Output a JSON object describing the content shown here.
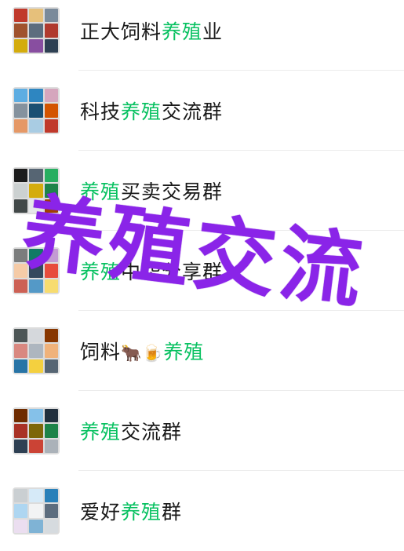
{
  "groups": [
    {
      "pre": "正大饲料",
      "hl": "养殖",
      "post": "业"
    },
    {
      "pre": "科技",
      "hl": "养殖",
      "post": "交流群"
    },
    {
      "pre": "",
      "hl": "养殖",
      "post": "买卖交易群"
    },
    {
      "pre": "",
      "hl": "养殖",
      "post": "中华分享群"
    },
    {
      "pre": "饲料",
      "emoji": "🐂🍺",
      "hl": "养殖",
      "post": ""
    },
    {
      "pre": "",
      "hl": "养殖",
      "post": "交流群"
    },
    {
      "pre": "爱好",
      "hl": "养殖",
      "post": "群"
    }
  ],
  "watermark": "养殖交流",
  "highlight_color": "#07c160",
  "watermark_color": "#8a24e8"
}
